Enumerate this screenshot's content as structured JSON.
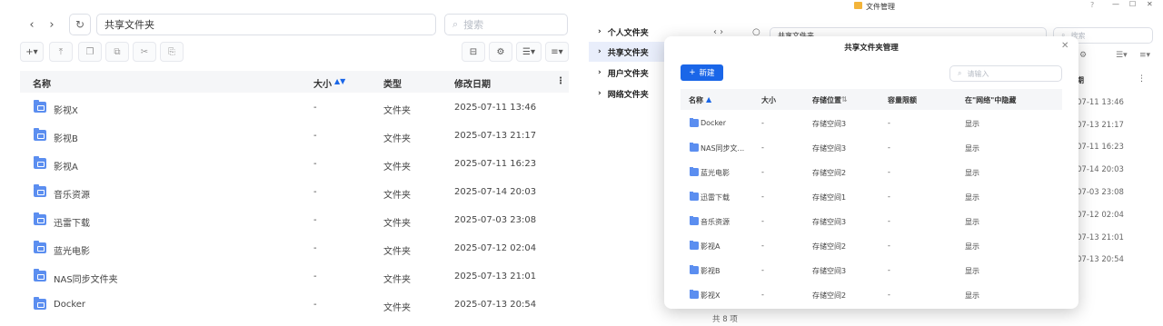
{
  "left_panel": {
    "path": "共享文件夹",
    "search_placeholder": "搜索",
    "columns": {
      "name": "名称",
      "size": "大小",
      "type": "类型",
      "modified": "修改日期"
    },
    "rows": [
      {
        "name": "影视X",
        "size": "-",
        "type": "文件夹",
        "modified": "2025-07-11 13:46"
      },
      {
        "name": "影视B",
        "size": "-",
        "type": "文件夹",
        "modified": "2025-07-13 21:17"
      },
      {
        "name": "影视A",
        "size": "-",
        "type": "文件夹",
        "modified": "2025-07-11 16:23"
      },
      {
        "name": "音乐资源",
        "size": "-",
        "type": "文件夹",
        "modified": "2025-07-14 20:03"
      },
      {
        "name": "迅雷下载",
        "size": "-",
        "type": "文件夹",
        "modified": "2025-07-03 23:08"
      },
      {
        "name": "蓝光电影",
        "size": "-",
        "type": "文件夹",
        "modified": "2025-07-12 02:04"
      },
      {
        "name": "NAS同步文件夹",
        "size": "-",
        "type": "文件夹",
        "modified": "2025-07-13 21:01"
      },
      {
        "name": "Docker",
        "size": "-",
        "type": "文件夹",
        "modified": "2025-07-13 20:54"
      }
    ]
  },
  "right_window": {
    "title": "文件管理",
    "sidebar": [
      "个人文件夹",
      "共享文件夹",
      "用户文件夹",
      "网络文件夹"
    ],
    "bg_path": "共享文件夹",
    "bg_search_placeholder": "搜索",
    "bg_header": "期",
    "bg_dates": [
      "07-11 13:46",
      "07-13 21:17",
      "07-11 16:23",
      "07-14 20:03",
      "07-03 23:08",
      "07-12 02:04",
      "07-13 21:01",
      "07-13 20:54"
    ],
    "footer": "共 8 项"
  },
  "modal": {
    "title": "共享文件夹管理",
    "new_button": "新建",
    "search_placeholder": "请输入",
    "columns": {
      "name": "名称",
      "size": "大小",
      "storage": "存储位置",
      "quota": "容量限额",
      "hide": "在\"网络\"中隐藏"
    },
    "rows": [
      {
        "name": "Docker",
        "size": "-",
        "storage": "存储空间3",
        "quota": "-",
        "hide": "显示"
      },
      {
        "name": "NAS同步文...",
        "size": "-",
        "storage": "存储空间3",
        "quota": "-",
        "hide": "显示"
      },
      {
        "name": "蓝光电影",
        "size": "-",
        "storage": "存储空间2",
        "quota": "-",
        "hide": "显示"
      },
      {
        "name": "迅雷下载",
        "size": "-",
        "storage": "存储空间1",
        "quota": "-",
        "hide": "显示"
      },
      {
        "name": "音乐资源",
        "size": "-",
        "storage": "存储空间3",
        "quota": "-",
        "hide": "显示"
      },
      {
        "name": "影视A",
        "size": "-",
        "storage": "存储空间2",
        "quota": "-",
        "hide": "显示"
      },
      {
        "name": "影视B",
        "size": "-",
        "storage": "存储空间3",
        "quota": "-",
        "hide": "显示"
      },
      {
        "name": "影视X",
        "size": "-",
        "storage": "存储空间2",
        "quota": "-",
        "hide": "显示"
      }
    ]
  },
  "colors": {
    "accent": "#1a66e8",
    "folder": "#5b8ef0",
    "header_bg": "#f5f6f8",
    "active_bg": "#e9eefb"
  }
}
